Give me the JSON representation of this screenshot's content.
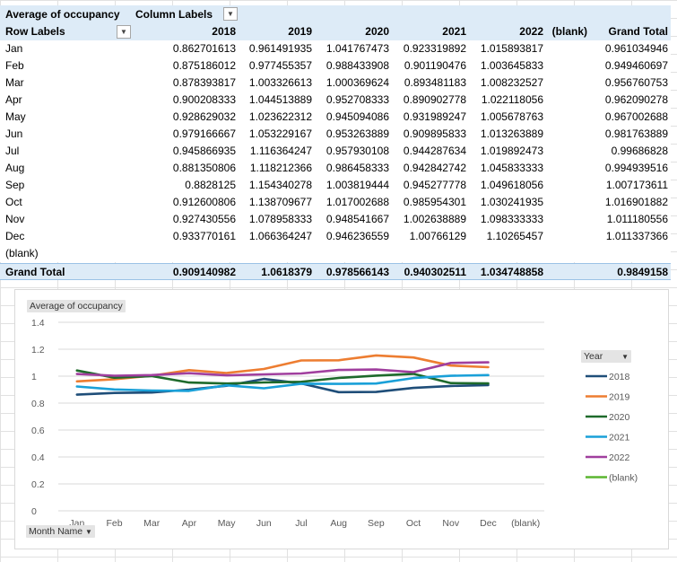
{
  "pivot": {
    "title": "Average of occupancy",
    "column_labels": "Column Labels",
    "row_labels": "Row Labels",
    "columns": [
      "2018",
      "2019",
      "2020",
      "2021",
      "2022",
      "(blank)",
      "Grand Total"
    ],
    "rows": [
      {
        "label": "Jan",
        "values": [
          "0.862701613",
          "0.961491935",
          "1.041767473",
          "0.923319892",
          "1.015893817",
          "",
          "0.961034946"
        ]
      },
      {
        "label": "Feb",
        "values": [
          "0.875186012",
          "0.977455357",
          "0.988433908",
          "0.901190476",
          "1.003645833",
          "",
          "0.949460697"
        ]
      },
      {
        "label": "Mar",
        "values": [
          "0.878393817",
          "1.003326613",
          "1.000369624",
          "0.893481183",
          "1.008232527",
          "",
          "0.956760753"
        ]
      },
      {
        "label": "Apr",
        "values": [
          "0.900208333",
          "1.044513889",
          "0.952708333",
          "0.890902778",
          "1.022118056",
          "",
          "0.962090278"
        ]
      },
      {
        "label": "May",
        "values": [
          "0.928629032",
          "1.023622312",
          "0.945094086",
          "0.931989247",
          "1.005678763",
          "",
          "0.967002688"
        ]
      },
      {
        "label": "Jun",
        "values": [
          "0.979166667",
          "1.053229167",
          "0.953263889",
          "0.909895833",
          "1.013263889",
          "",
          "0.981763889"
        ]
      },
      {
        "label": "Jul",
        "values": [
          "0.945866935",
          "1.116364247",
          "0.957930108",
          "0.944287634",
          "1.019892473",
          "",
          "0.99686828"
        ]
      },
      {
        "label": "Aug",
        "values": [
          "0.881350806",
          "1.118212366",
          "0.986458333",
          "0.942842742",
          "1.045833333",
          "",
          "0.994939516"
        ]
      },
      {
        "label": "Sep",
        "values": [
          "0.8828125",
          "1.154340278",
          "1.003819444",
          "0.945277778",
          "1.049618056",
          "",
          "1.007173611"
        ]
      },
      {
        "label": "Oct",
        "values": [
          "0.912600806",
          "1.138709677",
          "1.017002688",
          "0.985954301",
          "1.030241935",
          "",
          "1.016901882"
        ]
      },
      {
        "label": "Nov",
        "values": [
          "0.927430556",
          "1.078958333",
          "0.948541667",
          "1.002638889",
          "1.098333333",
          "",
          "1.011180556"
        ]
      },
      {
        "label": "Dec",
        "values": [
          "0.933770161",
          "1.066364247",
          "0.946236559",
          "1.00766129",
          "1.10265457",
          "",
          "1.011337366"
        ]
      },
      {
        "label": "(blank)",
        "values": [
          "",
          "",
          "",
          "",
          "",
          "",
          ""
        ]
      }
    ],
    "grand_total": {
      "label": "Grand Total",
      "values": [
        "0.909140982",
        "1.0618379",
        "0.978566143",
        "0.940302511",
        "1.034748858",
        "",
        "0.9849158"
      ]
    }
  },
  "chart_data": {
    "type": "line",
    "title": "",
    "field_buttons": {
      "value": "Average of occupancy",
      "axis": "Month Name",
      "legend": "Year"
    },
    "x": [
      "Jan",
      "Feb",
      "Mar",
      "Apr",
      "May",
      "Jun",
      "Jul",
      "Aug",
      "Sep",
      "Oct",
      "Nov",
      "Dec",
      "(blank)"
    ],
    "ylim": [
      0,
      1.4
    ],
    "yticks": [
      "0",
      "0.2",
      "0.4",
      "0.6",
      "0.8",
      "1",
      "1.2",
      "1.4"
    ],
    "grid": true,
    "legend_position": "right",
    "series": [
      {
        "name": "2018",
        "color": "#1f4e79",
        "values": [
          0.8627,
          0.8752,
          0.8784,
          0.9002,
          0.9286,
          0.9792,
          0.9459,
          0.8814,
          0.8828,
          0.9126,
          0.9274,
          0.9338,
          null
        ]
      },
      {
        "name": "2019",
        "color": "#ed7d31",
        "values": [
          0.9615,
          0.9775,
          1.0033,
          1.0445,
          1.0236,
          1.0532,
          1.1164,
          1.1182,
          1.1543,
          1.1387,
          1.079,
          1.0664,
          null
        ]
      },
      {
        "name": "2020",
        "color": "#1e6a2b",
        "values": [
          1.0418,
          0.9884,
          1.0004,
          0.9527,
          0.9451,
          0.9533,
          0.9579,
          0.9865,
          1.0038,
          1.017,
          0.9485,
          0.9462,
          null
        ]
      },
      {
        "name": "2021",
        "color": "#1aa0d8",
        "values": [
          0.9233,
          0.9012,
          0.8935,
          0.8909,
          0.932,
          0.9099,
          0.9443,
          0.9428,
          0.9453,
          0.986,
          1.0026,
          1.0077,
          null
        ]
      },
      {
        "name": "2022",
        "color": "#a03f9e",
        "values": [
          1.0159,
          1.0036,
          1.0082,
          1.0221,
          1.0057,
          1.0133,
          1.0199,
          1.0458,
          1.0496,
          1.0302,
          1.0983,
          1.1027,
          null
        ]
      },
      {
        "name": "(blank)",
        "color": "#5bb531",
        "values": [
          null,
          null,
          null,
          null,
          null,
          null,
          null,
          null,
          null,
          null,
          null,
          null,
          null
        ]
      }
    ]
  }
}
